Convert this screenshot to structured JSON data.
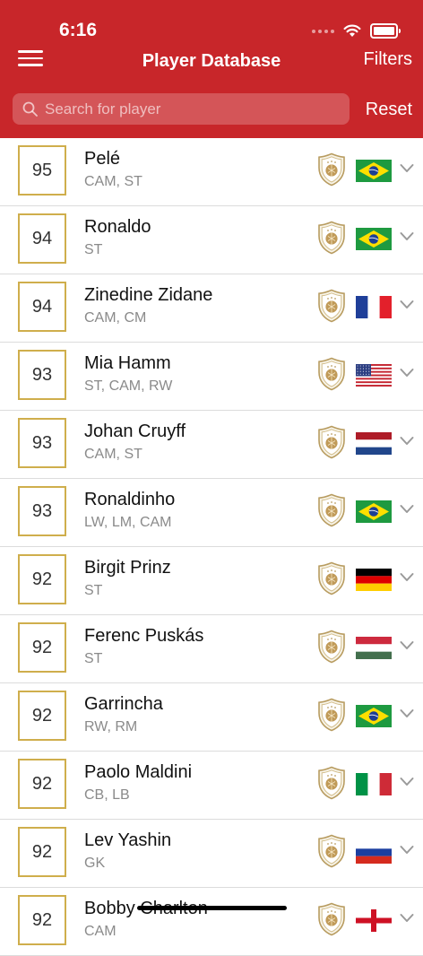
{
  "status": {
    "time": "6:16"
  },
  "header": {
    "title": "Player Database",
    "filters_label": "Filters",
    "reset_label": "Reset"
  },
  "search": {
    "placeholder": "Search for player"
  },
  "colors": {
    "header": "#c8262a",
    "rating_border": "#cfae4c"
  },
  "players": [
    {
      "rating": "95",
      "name": "Pelé",
      "positions": "CAM, ST",
      "nation": "brazil"
    },
    {
      "rating": "94",
      "name": "Ronaldo",
      "positions": "ST",
      "nation": "brazil"
    },
    {
      "rating": "94",
      "name": "Zinedine Zidane",
      "positions": "CAM, CM",
      "nation": "france"
    },
    {
      "rating": "93",
      "name": "Mia Hamm",
      "positions": "ST, CAM, RW",
      "nation": "usa"
    },
    {
      "rating": "93",
      "name": "Johan Cruyff",
      "positions": "CAM, ST",
      "nation": "netherlands"
    },
    {
      "rating": "93",
      "name": "Ronaldinho",
      "positions": "LW, LM, CAM",
      "nation": "brazil"
    },
    {
      "rating": "92",
      "name": "Birgit Prinz",
      "positions": "ST",
      "nation": "germany"
    },
    {
      "rating": "92",
      "name": "Ferenc Puskás",
      "positions": "ST",
      "nation": "hungary"
    },
    {
      "rating": "92",
      "name": "Garrincha",
      "positions": "RW, RM",
      "nation": "brazil"
    },
    {
      "rating": "92",
      "name": "Paolo Maldini",
      "positions": "CB, LB",
      "nation": "italy"
    },
    {
      "rating": "92",
      "name": "Lev Yashin",
      "positions": "GK",
      "nation": "russia"
    },
    {
      "rating": "92",
      "name": "Bobby Charlton",
      "positions": "CAM",
      "nation": "england"
    }
  ]
}
